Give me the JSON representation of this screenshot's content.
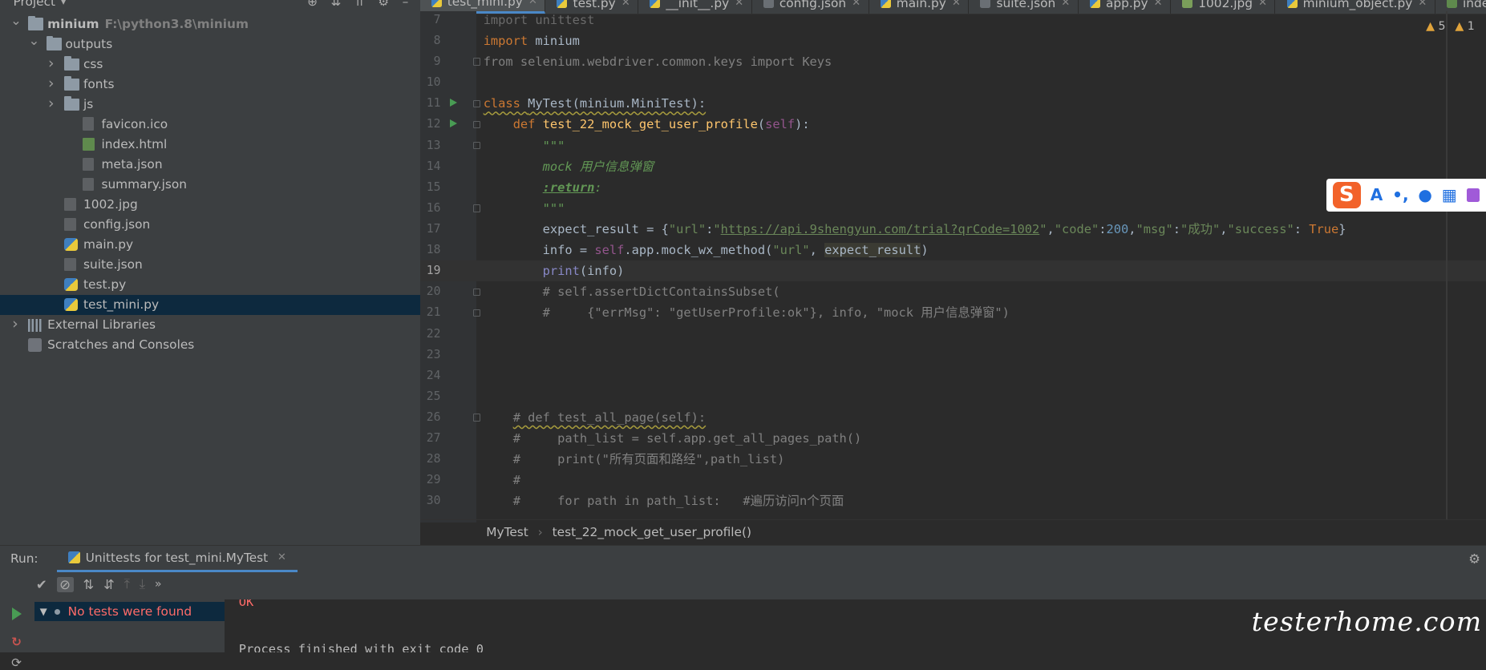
{
  "project": {
    "title": "Project",
    "tree": [
      {
        "label": "minium",
        "extra": "F:\\python3.8\\minium",
        "depth": 0,
        "arrow": "down",
        "icon": "folder",
        "bold": true
      },
      {
        "label": "outputs",
        "depth": 1,
        "arrow": "down",
        "icon": "folder"
      },
      {
        "label": "css",
        "depth": 2,
        "arrow": "right",
        "icon": "folder"
      },
      {
        "label": "fonts",
        "depth": 2,
        "arrow": "right",
        "icon": "folder"
      },
      {
        "label": "js",
        "depth": 2,
        "arrow": "right",
        "icon": "folder"
      },
      {
        "label": "favicon.ico",
        "depth": 3,
        "icon": "file"
      },
      {
        "label": "index.html",
        "depth": 3,
        "icon": "html"
      },
      {
        "label": "meta.json",
        "depth": 3,
        "icon": "json"
      },
      {
        "label": "summary.json",
        "depth": 3,
        "icon": "json"
      },
      {
        "label": "1002.jpg",
        "depth": 2,
        "icon": "file"
      },
      {
        "label": "config.json",
        "depth": 2,
        "icon": "json"
      },
      {
        "label": "main.py",
        "depth": 2,
        "icon": "py"
      },
      {
        "label": "suite.json",
        "depth": 2,
        "icon": "json"
      },
      {
        "label": "test.py",
        "depth": 2,
        "icon": "py"
      },
      {
        "label": "test_mini.py",
        "depth": 2,
        "icon": "py",
        "selected": true
      },
      {
        "label": "External Libraries",
        "depth": 0,
        "arrow": "right",
        "icon": "lib"
      },
      {
        "label": "Scratches and Consoles",
        "depth": 0,
        "icon": "scratch"
      }
    ]
  },
  "editor": {
    "tabs": [
      {
        "label": "test_mini.py",
        "icon": "py",
        "active": true
      },
      {
        "label": "test.py",
        "icon": "py"
      },
      {
        "label": "__init__.py",
        "icon": "py"
      },
      {
        "label": "config.json",
        "icon": "json"
      },
      {
        "label": "main.py",
        "icon": "py"
      },
      {
        "label": "suite.json",
        "icon": "json"
      },
      {
        "label": "app.py",
        "icon": "py"
      },
      {
        "label": "1002.jpg",
        "icon": "img"
      },
      {
        "label": "minium_object.py",
        "icon": "py"
      },
      {
        "label": "index.h",
        "icon": "html"
      }
    ],
    "inspections": {
      "warnings": "5",
      "weak": "1"
    },
    "current_line": 19,
    "lines": [
      {
        "n": "7",
        "tokens": [
          [
            "kw mute",
            "import "
          ],
          [
            "mute",
            "unittest"
          ]
        ]
      },
      {
        "n": "8",
        "tokens": [
          [
            "kw",
            "import "
          ],
          [
            "",
            "minium"
          ]
        ]
      },
      {
        "n": "9",
        "fold": true,
        "tokens": [
          [
            "cmt",
            "from selenium.webdriver.common.keys import Keys"
          ]
        ]
      },
      {
        "n": "10",
        "tokens": []
      },
      {
        "n": "11",
        "run": true,
        "fold": true,
        "tokens": [
          [
            "kw wavy",
            "class "
          ],
          [
            "wavy",
            "MyTest(minium.MiniTest):"
          ]
        ]
      },
      {
        "n": "12",
        "run": true,
        "fold": true,
        "tokens": [
          [
            "",
            "    "
          ],
          [
            "kw",
            "def "
          ],
          [
            "fn",
            "test_22_mock_get_user_profile"
          ],
          [
            "",
            "("
          ],
          [
            "self",
            "self"
          ],
          [
            "",
            "):"
          ]
        ]
      },
      {
        "n": "13",
        "fold": true,
        "tokens": [
          [
            "",
            "        "
          ],
          [
            "doc",
            "\"\"\""
          ]
        ]
      },
      {
        "n": "14",
        "tokens": [
          [
            "",
            "        "
          ],
          [
            "doc",
            "mock 用户信息弹窗"
          ]
        ]
      },
      {
        "n": "15",
        "tokens": [
          [
            "",
            "        "
          ],
          [
            "doctag",
            ":return"
          ],
          [
            "doc",
            ":"
          ]
        ]
      },
      {
        "n": "16",
        "fold": true,
        "tokens": [
          [
            "",
            "        "
          ],
          [
            "doc",
            "\"\"\""
          ]
        ]
      },
      {
        "n": "17",
        "tokens": [
          [
            "",
            "        expect_result = {"
          ],
          [
            "str",
            "\"url\""
          ],
          [
            "",
            ":"
          ],
          [
            "str",
            "\""
          ],
          [
            "url",
            "https://api.9shengyun.com/trial?qrCode=1002"
          ],
          [
            "str",
            "\""
          ],
          [
            "",
            ","
          ],
          [
            "str",
            "\"code\""
          ],
          [
            "",
            ":"
          ],
          [
            "num",
            "200"
          ],
          [
            "",
            ","
          ],
          [
            "str",
            "\"msg\""
          ],
          [
            "",
            ":"
          ],
          [
            "str",
            "\"成功\""
          ],
          [
            "",
            ","
          ],
          [
            "str",
            "\"success\""
          ],
          [
            "",
            ": "
          ],
          [
            "kw",
            "True"
          ],
          [
            "",
            "}"
          ]
        ]
      },
      {
        "n": "18",
        "tokens": [
          [
            "",
            "        info = "
          ],
          [
            "self",
            "self"
          ],
          [
            "",
            ".app.mock_wx_method("
          ],
          [
            "str",
            "\"url\""
          ],
          [
            "",
            ", "
          ],
          [
            "hl",
            "expect_result"
          ],
          [
            "",
            ")"
          ]
        ]
      },
      {
        "n": "19",
        "tokens": [
          [
            "",
            "        "
          ],
          [
            "builtin",
            "print"
          ],
          [
            "",
            "(info)"
          ]
        ]
      },
      {
        "n": "20",
        "fold": true,
        "tokens": [
          [
            "",
            "        "
          ],
          [
            "cmt",
            "# self.assertDictContainsSubset("
          ]
        ]
      },
      {
        "n": "21",
        "fold": true,
        "tokens": [
          [
            "",
            "        "
          ],
          [
            "cmt",
            "#     {\"errMsg\": \"getUserProfile:ok\"}, info, \"mock 用户信息弹窗\")"
          ]
        ]
      },
      {
        "n": "22",
        "tokens": []
      },
      {
        "n": "23",
        "tokens": []
      },
      {
        "n": "24",
        "tokens": []
      },
      {
        "n": "25",
        "tokens": []
      },
      {
        "n": "26",
        "fold": true,
        "tokens": [
          [
            "",
            "    "
          ],
          [
            "cmt wavy",
            "# def test_all_page(self):"
          ]
        ]
      },
      {
        "n": "27",
        "tokens": [
          [
            "",
            "    "
          ],
          [
            "cmt",
            "#     path_list = self.app.get_all_pages_path()"
          ]
        ]
      },
      {
        "n": "28",
        "tokens": [
          [
            "",
            "    "
          ],
          [
            "cmt",
            "#     print(\"所有页面和路经\",path_list)"
          ]
        ]
      },
      {
        "n": "29",
        "tokens": [
          [
            "",
            "    "
          ],
          [
            "cmt",
            "#"
          ]
        ]
      },
      {
        "n": "30",
        "tokens": [
          [
            "",
            "    "
          ],
          [
            "cmt",
            "#     for path in path_list:   #遍历访问n个页面"
          ]
        ]
      }
    ],
    "breadcrumbs": [
      "MyTest",
      "test_22_mock_get_user_profile()"
    ]
  },
  "ime": {
    "brand": "S",
    "items": [
      "A",
      "•,",
      "mic",
      "keyboard",
      "skin"
    ]
  },
  "run": {
    "title": "Run:",
    "tab_label": "Unittests for test_mini.MyTest",
    "tree_message": "No tests were found",
    "console_ok": "OK",
    "console_finished": "Process finished with exit code 0"
  },
  "watermark": "testerhome.com"
}
